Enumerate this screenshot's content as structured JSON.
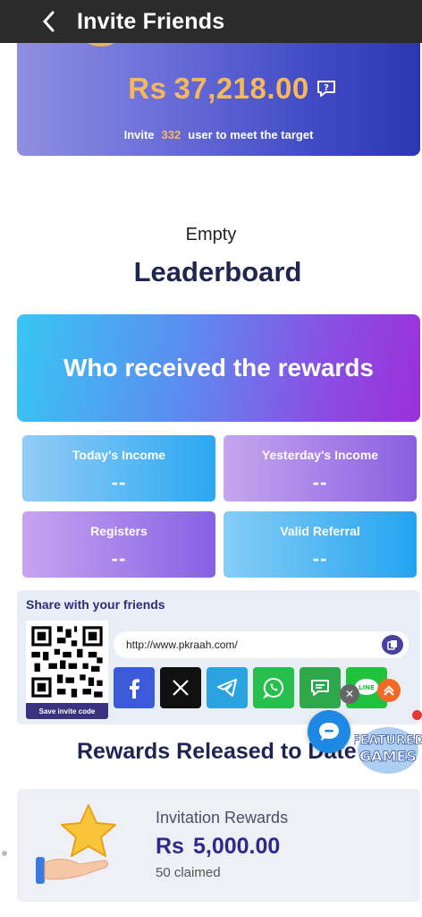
{
  "header": {
    "title": "Invite Friends",
    "back_icon": "chevron-left-icon"
  },
  "hero": {
    "currency": "Rs",
    "amount": "37,218.00",
    "invite_prefix": "Invite",
    "invite_count": "332",
    "invite_suffix": "user to meet the target"
  },
  "leaderboard": {
    "empty_text": "Empty",
    "title": "Leaderboard"
  },
  "rewards_banner": "Who received the rewards",
  "stats": [
    {
      "label": "Today's Income",
      "value": "--"
    },
    {
      "label": "Yesterday's Income",
      "value": "--"
    },
    {
      "label": "Registers",
      "value": "--"
    },
    {
      "label": "Valid Referral",
      "value": "--"
    }
  ],
  "share": {
    "title": "Share with your friends",
    "save_label": "Save invite code",
    "url": "http://www.pkraah.com/",
    "social": [
      {
        "name": "facebook",
        "color": "#3b5bdb"
      },
      {
        "name": "x",
        "color": "#111111"
      },
      {
        "name": "telegram",
        "color": "#2aa3e0"
      },
      {
        "name": "whatsapp",
        "color": "#27c04e"
      },
      {
        "name": "sms",
        "color": "#2ea84a"
      },
      {
        "name": "line",
        "color": "#1fc23a"
      }
    ]
  },
  "released": {
    "title": "Rewards Released to Date",
    "card": {
      "label": "Invitation Rewards",
      "currency": "Rs",
      "amount": "5,000.00",
      "claimed": "50 claimed"
    }
  },
  "floating": {
    "featured_text": "FEATURED GAMES"
  },
  "colors": {
    "accent": "#f7b85c",
    "header_bg": "#2b2b2b",
    "title": "#1f2550"
  }
}
